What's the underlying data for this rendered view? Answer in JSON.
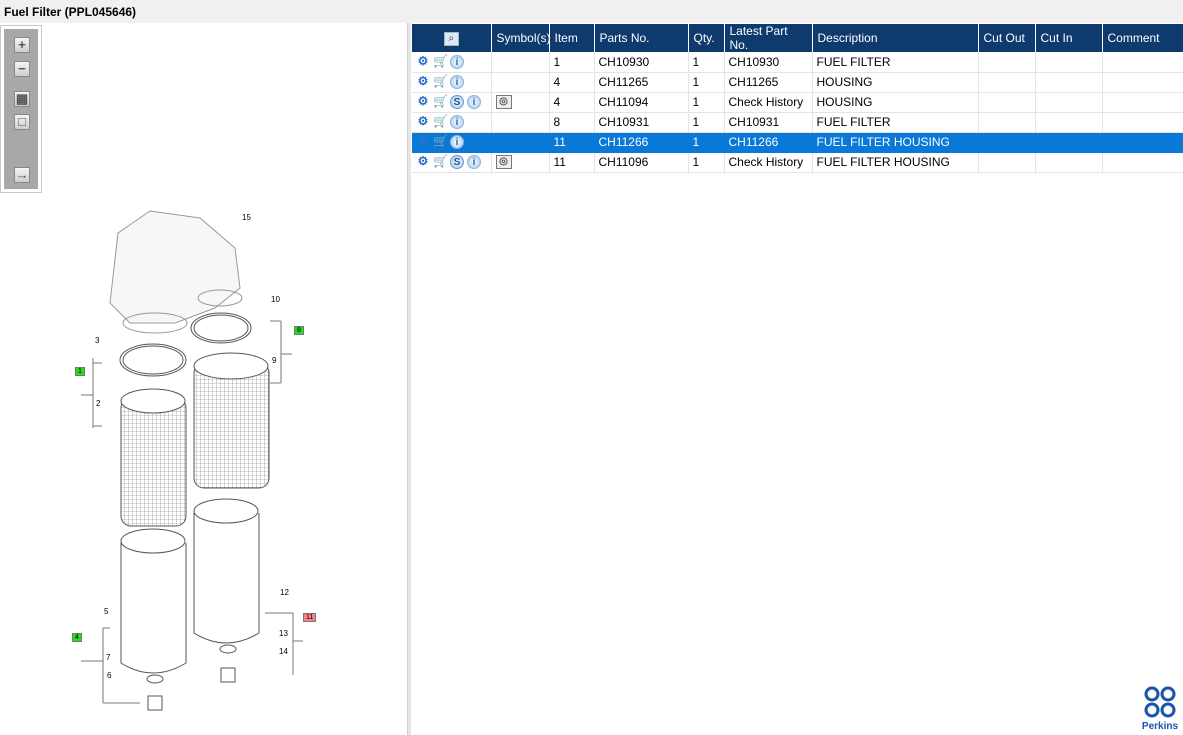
{
  "window": {
    "title": "Fuel Filter (PPL045646)"
  },
  "toolbar": [
    {
      "name": "zoom-in",
      "glyph": "+"
    },
    {
      "name": "zoom-out",
      "glyph": "−"
    },
    {
      "name": "fit-all",
      "glyph": "▦"
    },
    {
      "name": "actual-size",
      "glyph": "□"
    },
    {
      "name": "export",
      "glyph": "→"
    }
  ],
  "diagram": {
    "callouts": [
      "15",
      "10",
      "3",
      "9",
      "2",
      "12",
      "13",
      "14",
      "5",
      "7",
      "6"
    ],
    "badges": [
      {
        "label": "8",
        "color": "#22dd22"
      },
      {
        "label": "1",
        "color": "#22dd22"
      },
      {
        "label": "4",
        "color": "#22dd22"
      },
      {
        "label": "11",
        "color": "#ff8080"
      }
    ]
  },
  "table": {
    "columns": [
      "",
      "Symbol(s)",
      "Item",
      "Parts No.",
      "Qty.",
      "Latest Part No.",
      "Description",
      "Cut Out",
      "Cut In",
      "Comment"
    ],
    "rows": [
      {
        "supersede": false,
        "history": false,
        "item": "1",
        "part": "CH10930",
        "qty": "1",
        "latest": "CH10930",
        "desc": "FUEL FILTER",
        "selected": false
      },
      {
        "supersede": false,
        "history": false,
        "item": "4",
        "part": "CH11265",
        "qty": "1",
        "latest": "CH11265",
        "desc": "HOUSING",
        "selected": false
      },
      {
        "supersede": true,
        "history": true,
        "item": "4",
        "part": "CH11094",
        "qty": "1",
        "latest": "Check History",
        "desc": "HOUSING",
        "selected": false
      },
      {
        "supersede": false,
        "history": false,
        "item": "8",
        "part": "CH10931",
        "qty": "1",
        "latest": "CH10931",
        "desc": "FUEL FILTER",
        "selected": false
      },
      {
        "supersede": false,
        "history": false,
        "item": "11",
        "part": "CH11266",
        "qty": "1",
        "latest": "CH11266",
        "desc": "FUEL FILTER HOUSING",
        "selected": true
      },
      {
        "supersede": true,
        "history": true,
        "item": "11",
        "part": "CH11096",
        "qty": "1",
        "latest": "Check History",
        "desc": "FUEL FILTER HOUSING",
        "selected": false
      }
    ]
  },
  "brand": {
    "name": "Perkins",
    "color": "#1a55a8"
  }
}
